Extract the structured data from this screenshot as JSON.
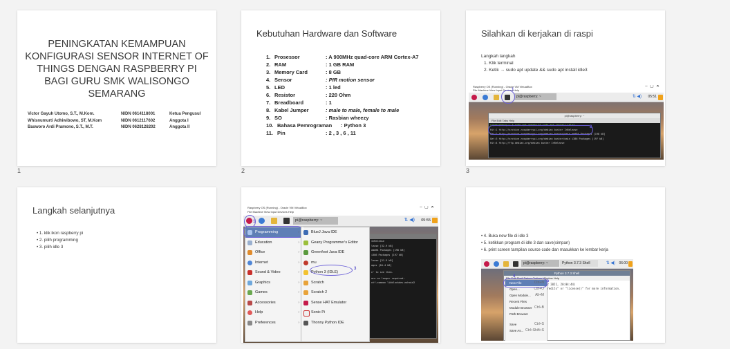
{
  "slide_numbers": [
    "1",
    "2",
    "3",
    "4",
    "5",
    "6"
  ],
  "slide1": {
    "title": "PENINGKATAN KEMAMPUAN KONFIGURASI SENSOR INTERNET OF THINGS DENGAN RASPBERRY PI BAGI GURU SMK WALISONGO SEMARANG",
    "authors": [
      {
        "name": "Victor Gayuh Utomo, S.T., M.Kom.",
        "nidn": "NIDN 0614118001",
        "role": "Ketua Pengusul"
      },
      {
        "name": "Whisnumurti Adhiwibowo, ST, M.Kom",
        "nidn": "NIDN 0612117602",
        "role": "Anggota I"
      },
      {
        "name": "Basworo Ardi Pramono, S.T., M.T.",
        "nidn": "NIDN 0628128202",
        "role": "Anggota II"
      }
    ]
  },
  "slide2": {
    "title": "Kebutuhan Hardware dan Software",
    "items": [
      {
        "n": "1.",
        "k": "Prosessor",
        "v": ": A 900MHz quad-core ARM Cortex-A7"
      },
      {
        "n": "2.",
        "k": "RAM",
        "v": ": 1 GB RAM"
      },
      {
        "n": "3.",
        "k": "Memory Card",
        "v": ": 8 GB"
      },
      {
        "n": "4.",
        "k": "Sensor",
        "v": ": PIR motion sensor"
      },
      {
        "n": "5.",
        "k": "LED",
        "v": ": 1 led"
      },
      {
        "n": "6.",
        "k": "Resistor",
        "v": ": 220 Ohm"
      },
      {
        "n": "7.",
        "k": "Breadboard",
        "v": ": 1"
      },
      {
        "n": "8.",
        "k": "Kabel Jumper",
        "v": ": male to male, female to male"
      },
      {
        "n": "9.",
        "k": "SO",
        "v": ": Rasbian wheezy"
      },
      {
        "n": "10.",
        "k": "Bahasa Pemrograman",
        "v": ": Python 3"
      },
      {
        "n": "11.",
        "k": "Pin",
        "v": ": 2 , 3 , 6 , 11"
      }
    ]
  },
  "slide3": {
    "title": "Silahkan di kerjakan di raspi",
    "intro": "Langkah langkah",
    "steps": [
      "1.   Klik terminal",
      "2.   Ketik → sudo apt update && sudo apt install idle3"
    ],
    "window_title": "Raspberry OS (Running) - Oracle VM VirtualBox",
    "menubar": "File   Machine   View   Input   Devices   Help",
    "user_label": "pi@raspberry: ~",
    "clock": "05:51",
    "terminal_title": "pi@raspberry: ~",
    "terminal_menu": "File   Edit   Tabs   Help",
    "terminal_lines": [
      "pi@raspberry:~ $ sudo apt update && sudo apt install idle3",
      "Hit:1 http://archive.raspberrypi.org/debian buster InRelease",
      "Get:2 http://archive.raspberrypi.org/debian buster/main amd64 Packages [198 kB]",
      "Get:3 http://archive.raspberrypi.org/debian buster/main i386 Packages [197 kB]",
      "Hit:4 http://ftp.debian.org/debian buster InRelease"
    ],
    "badges": [
      "1",
      "2"
    ]
  },
  "slide4": {
    "title": "Langkah selanjutnya",
    "bullets": [
      "• 1. klik ikon raspberry pi",
      "• 2. pilih programming",
      "• 3. pilih idle 3"
    ]
  },
  "slide5": {
    "window_title": "Raspberry OS (Running) - Oracle VM VirtualBox",
    "menubar": "File   Machine   View   Input   Devices   Help",
    "user_label": "pi@raspberry: ~",
    "clock": "05:55",
    "menu_items": [
      "Programming",
      "Education",
      "Office",
      "Internet",
      "Sound & Video",
      "Graphics",
      "Games",
      "Accessories",
      "Help",
      "Preferences"
    ],
    "submenu_items": [
      "BlueJ Java IDE",
      "Geany Programmer's Editor",
      "Greenfoot Java IDE",
      "mu",
      "Python 3 (IDLE)",
      "Scratch",
      "Scratch 2",
      "Sense HAT Emulator",
      "Sonic Pi",
      "Thonny Python IDE"
    ],
    "terminal_lines": [
      "InRelease",
      "lease [32.9 kB]",
      "amd64 Packages [198 kB]",
      "i386 Packages [197 kB]",
      "",
      "lease [51.9 kB]",
      "ages [84.4 kB]",
      "",
      "",
      "e' to see them.",
      "",
      "are no longer required:",
      "ntf-common libblockdev-mdraid2"
    ],
    "badges": [
      "1",
      "2",
      "3"
    ]
  },
  "slide6": {
    "bullets": [
      "• 4. Buka new file di idle 3",
      "• 5. ketikkan program di idle 3 dan save(simpan)",
      "• 6. print screen tampilan source code dan masukkan ke lembar kerja"
    ],
    "user_label": "pi@raspberry: ~",
    "python_tab": "Python 3.7.3 Shell",
    "clock": "06:00",
    "shell_title": "Python 3.7.3 Shell",
    "shell_menu": "File   Edit   Shell   Debug   Options   Window   Help",
    "file_menu": [
      {
        "label": "New File",
        "key": "Ctrl+N"
      },
      {
        "label": "Open...",
        "key": "Ctrl+O"
      },
      {
        "label": "Open Module...",
        "key": "Alt+M"
      },
      {
        "label": "Recent Files",
        "key": ""
      },
      {
        "label": "Module Browser",
        "key": "Ctrl+B"
      },
      {
        "label": "Path Browser",
        "key": ""
      },
      {
        "label": "Save",
        "key": "Ctrl+S"
      },
      {
        "label": "Save As...",
        "key": "Ctrl+Shift+S"
      }
    ],
    "shell_lines": [
      "12 2021, 20:04:44)",
      "credits\" or \"license()\" for more information."
    ],
    "badges": [
      "4",
      "5"
    ]
  }
}
